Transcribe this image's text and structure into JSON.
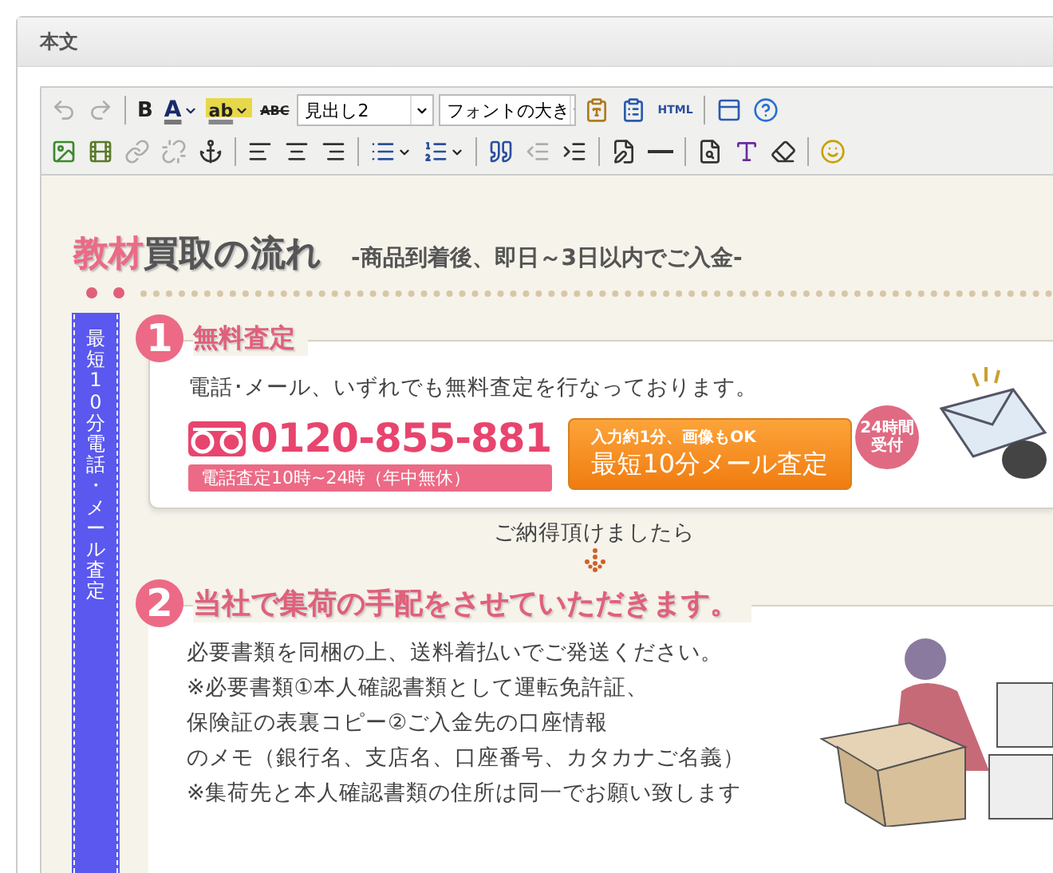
{
  "window": {
    "title": "本文"
  },
  "toolbar": {
    "rows": [
      [
        {
          "kind": "undo",
          "disabled": true
        },
        {
          "kind": "redo",
          "disabled": true
        },
        {
          "kind": "separator"
        },
        {
          "kind": "bold",
          "label": "B"
        },
        {
          "kind": "fontcolor",
          "label": "A",
          "has_menu": true
        },
        {
          "kind": "highlight",
          "label": "ab",
          "has_menu": true
        },
        {
          "kind": "spellcheck",
          "label": "ABC"
        },
        {
          "kind": "select",
          "value": "見出し2"
        },
        {
          "kind": "select",
          "value": "フォントの大き"
        },
        {
          "kind": "pastetext"
        },
        {
          "kind": "pasteword"
        },
        {
          "kind": "html",
          "label": "HTML"
        },
        {
          "kind": "separator"
        },
        {
          "kind": "fullscreen"
        },
        {
          "kind": "help"
        }
      ],
      [
        {
          "kind": "image"
        },
        {
          "kind": "media"
        },
        {
          "kind": "link",
          "disabled": true
        },
        {
          "kind": "unlink",
          "disabled": true
        },
        {
          "kind": "anchor"
        },
        {
          "kind": "separator"
        },
        {
          "kind": "alignleft"
        },
        {
          "kind": "aligncenter"
        },
        {
          "kind": "alignright"
        },
        {
          "kind": "separator"
        },
        {
          "kind": "bullets",
          "has_menu": true
        },
        {
          "kind": "numbers",
          "has_menu": true
        },
        {
          "kind": "separator"
        },
        {
          "kind": "quote"
        },
        {
          "kind": "outdent",
          "disabled": true
        },
        {
          "kind": "indent"
        },
        {
          "kind": "separator"
        },
        {
          "kind": "table"
        },
        {
          "kind": "rule"
        },
        {
          "kind": "separator"
        },
        {
          "kind": "preview"
        },
        {
          "kind": "style"
        },
        {
          "kind": "eraser"
        },
        {
          "kind": "separator"
        },
        {
          "kind": "emoji"
        }
      ]
    ]
  },
  "content": {
    "heading": {
      "accent": "教材",
      "rest": "買取の流れ",
      "subtitle": "-商品到着後、即日～3日以内でご入金-"
    },
    "side_banner": "最短10分電話・メール査定",
    "steps": [
      {
        "number": "1",
        "title": "無料査定",
        "text": "電話･メール、いずれでも無料査定を行なっております。",
        "phone": {
          "number": "0120-855-881",
          "hours": "電話査定10時~24時（年中無休）"
        },
        "mail_button": {
          "note": "入力約**1**分、画像もOK",
          "label": "最短10分メール査定",
          "badge": [
            "24時間",
            "受付"
          ]
        }
      },
      {
        "number": "2",
        "title": "当社で集荷の手配をさせていただきます。",
        "lines": [
          "必要書類を同梱の上、送料着払いでご発送ください。",
          "※必要書類①本人確認書類として運転免許証、",
          "保険証の表裏コピー②ご入金先の口座情報",
          "のメモ（銀行名、支店名、口座番号、カタカナご名義）",
          "※集荷先と本人確認書類の住所は同一でお願い致します"
        ]
      }
    ],
    "between": "ご納得頂けましたら"
  }
}
